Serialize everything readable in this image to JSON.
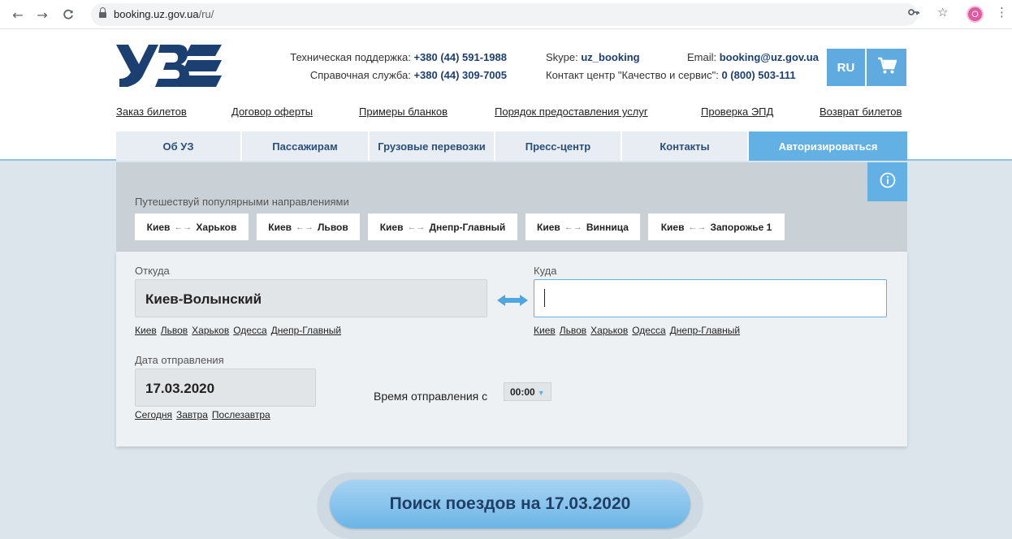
{
  "browser": {
    "url_host": "booking.uz.gov.ua",
    "url_path": "/ru/",
    "avatar_letter": "O",
    "icons": [
      "back-icon",
      "forward-icon",
      "reload-icon",
      "lock-icon",
      "key-icon",
      "star-icon",
      "menu-icon"
    ]
  },
  "header": {
    "support_label": "Техническая поддержка: ",
    "support_phone": "+380 (44) 591-1988",
    "help_label": "Справочная служба: ",
    "help_phone": "+380 (44) 309-7005",
    "skype_label": "Skype: ",
    "skype_value": "uz_booking",
    "contact_label": "Контакт центр \"Качество и сервис\": ",
    "contact_phone": "0 (800) 503-111",
    "email_label": "Email: ",
    "email_value": "booking@uz.gov.ua",
    "lang": "RU",
    "brand_color": "#1c3f72",
    "accent_color": "#62b0e4"
  },
  "toplinks": [
    "Заказ билетов",
    "Договор оферты",
    "Примеры бланков",
    "Порядок предоставления услуг",
    "Проверка ЭПД",
    "Возврат билетов"
  ],
  "mainnav": [
    "Об УЗ",
    "Пассажирам",
    "Грузовые перевозки",
    "Пресс-центр",
    "Контакты",
    "Авторизироваться"
  ],
  "popular": {
    "title": "Путешествуй популярными направлениями",
    "routes": [
      {
        "from": "Киев",
        "to": "Харьков"
      },
      {
        "from": "Киев",
        "to": "Львов"
      },
      {
        "from": "Киев",
        "to": "Днепр-Главный"
      },
      {
        "from": "Киев",
        "to": "Винница"
      },
      {
        "from": "Киев",
        "to": "Запорожье 1"
      }
    ]
  },
  "form": {
    "from_label": "Откуда",
    "from_value": "Киев-Волынский",
    "to_label": "Куда",
    "to_value": "",
    "from_quick": [
      "Киев",
      "Львов",
      "Харьков",
      "Одесса",
      "Днепр-Главный"
    ],
    "to_quick": [
      "Киев",
      "Львов",
      "Харьков",
      "Одесса",
      "Днепр-Главный"
    ],
    "date_label": "Дата отправления",
    "date_value": "17.03.2020",
    "date_quick": [
      "Сегодня",
      "Завтра",
      "Послезавтра"
    ],
    "time_label": "Время отправления с",
    "time_value": "00:00"
  },
  "search_button": "Поиск поездов на 17.03.2020"
}
